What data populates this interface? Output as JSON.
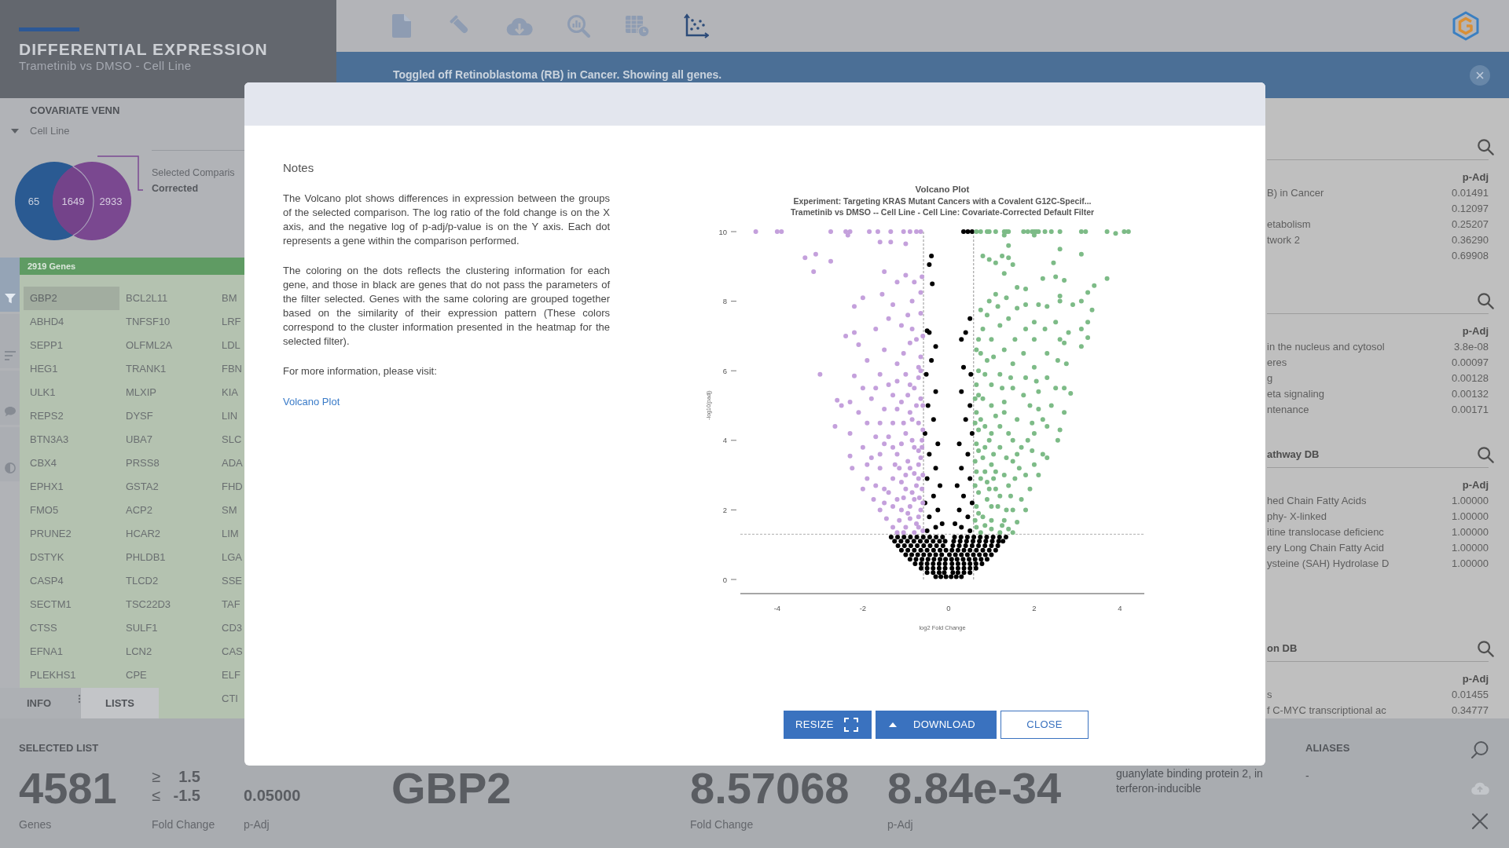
{
  "header": {
    "title": "DIFFERENTIAL EXPRESSION",
    "subtitle": "Trametinib vs DMSO - Cell Line"
  },
  "toolbar": [
    {
      "kind": "document",
      "selected": false
    },
    {
      "kind": "test-tube",
      "selected": false
    },
    {
      "kind": "cloud-download",
      "selected": false
    },
    {
      "kind": "magnifier-chart",
      "selected": false
    },
    {
      "kind": "table-clock",
      "selected": false
    },
    {
      "kind": "scatter-plot",
      "selected": true
    }
  ],
  "notification": {
    "message": "Toggled off Retinoblastoma (RB) in Cancer. Showing all genes."
  },
  "venn": {
    "title": "COVARIATE VENN",
    "dropdown": "Cell Line",
    "left_count": "65",
    "overlap_count": "1649",
    "right_count": "2933",
    "legend_label": "Selected Comparis",
    "legend_value": "Corrected"
  },
  "side_tools": [
    {
      "kind": "filter",
      "selected": true
    },
    {
      "kind": "sort",
      "selected": false
    },
    {
      "kind": "comment",
      "selected": false
    },
    {
      "kind": "contrast",
      "selected": false
    }
  ],
  "gene_list": {
    "header": "2919 Genes",
    "columns": [
      [
        {
          "name": "GBP2",
          "selected": true
        },
        {
          "name": "ABHD4",
          "selected": false
        },
        {
          "name": "SEPP1",
          "selected": false
        },
        {
          "name": "HEG1",
          "selected": false
        },
        {
          "name": "ULK1",
          "selected": false
        },
        {
          "name": "REPS2",
          "selected": false
        },
        {
          "name": "BTN3A3",
          "selected": false
        },
        {
          "name": "CBX4",
          "selected": false
        },
        {
          "name": "EPHX1",
          "selected": false
        },
        {
          "name": "FMO5",
          "selected": false
        },
        {
          "name": "PRUNE2",
          "selected": false
        },
        {
          "name": "DSTYK",
          "selected": false
        },
        {
          "name": "CASP4",
          "selected": false
        },
        {
          "name": "SECTM1",
          "selected": false
        },
        {
          "name": "CTSS",
          "selected": false
        },
        {
          "name": "EFNA1",
          "selected": false
        },
        {
          "name": "PLEKHS1",
          "selected": false
        }
      ],
      [
        {
          "name": "BCL2L11",
          "selected": false
        },
        {
          "name": "TNFSF10",
          "selected": false
        },
        {
          "name": "OLFML2A",
          "selected": false
        },
        {
          "name": "TRANK1",
          "selected": false
        },
        {
          "name": "MLXIP",
          "selected": false
        },
        {
          "name": "DYSF",
          "selected": false
        },
        {
          "name": "UBA7",
          "selected": false
        },
        {
          "name": "PRSS8",
          "selected": false
        },
        {
          "name": "GSTA2",
          "selected": false
        },
        {
          "name": "ACP2",
          "selected": false
        },
        {
          "name": "HCAR2",
          "selected": false
        },
        {
          "name": "PHLDB1",
          "selected": false
        },
        {
          "name": "TLCD2",
          "selected": false
        },
        {
          "name": "TSC22D3",
          "selected": false
        },
        {
          "name": "SULF1",
          "selected": false
        },
        {
          "name": "LCN2",
          "selected": false
        },
        {
          "name": "CPE",
          "selected": false
        }
      ],
      [
        {
          "name": "BM",
          "selected": false
        },
        {
          "name": "LRF",
          "selected": false
        },
        {
          "name": "LDL",
          "selected": false
        },
        {
          "name": "FBN",
          "selected": false
        },
        {
          "name": "KIA",
          "selected": false
        },
        {
          "name": "LIN",
          "selected": false
        },
        {
          "name": "SLC",
          "selected": false
        },
        {
          "name": "ADA",
          "selected": false
        },
        {
          "name": "FHD",
          "selected": false
        },
        {
          "name": "SM",
          "selected": false
        },
        {
          "name": "LIM",
          "selected": false
        },
        {
          "name": "LGA",
          "selected": false
        },
        {
          "name": "SSE",
          "selected": false
        },
        {
          "name": "TAF",
          "selected": false
        },
        {
          "name": "CD3",
          "selected": false
        },
        {
          "name": "CAS",
          "selected": false
        },
        {
          "name": "ELF",
          "selected": false
        },
        {
          "name": "CTI",
          "selected": false
        }
      ]
    ]
  },
  "tabs": [
    {
      "label": "INFO",
      "selected": false
    },
    {
      "label": "LISTS",
      "selected": true
    }
  ],
  "right_panel": {
    "sections": [
      {
        "column_header": "p-Adj",
        "rows": [
          {
            "name": "B) in Cancer",
            "p_adj": "0.01491"
          },
          {
            "p_adj": "0.12097"
          },
          {
            "name": "etabolism",
            "p_adj": "0.25207"
          },
          {
            "name": "twork 2",
            "p_adj": "0.36290"
          },
          {
            "p_adj": "0.69908"
          }
        ]
      },
      {
        "column_header": "p-Adj",
        "rows": [
          {
            "name": "in the nucleus and cytosol",
            "p_adj": "3.8e-08"
          },
          {
            "name": "eres",
            "p_adj": "0.00097"
          },
          {
            "name": "g",
            "p_adj": "0.00128"
          },
          {
            "name": "eta signaling",
            "p_adj": "0.00132"
          },
          {
            "name": "ntenance",
            "p_adj": "0.00171"
          }
        ]
      },
      {
        "title": "athway DB",
        "column_header": "p-Adj",
        "rows": [
          {
            "name": "hed Chain Fatty Acids",
            "p_adj": "1.00000"
          },
          {
            "name": "phy- X-linked",
            "p_adj": "1.00000"
          },
          {
            "name": "itine translocase deficienc",
            "p_adj": "1.00000"
          },
          {
            "name": "ery Long Chain Fatty Acid",
            "p_adj": "1.00000"
          },
          {
            "name": "ysteine (SAH) Hydrolase D",
            "p_adj": "1.00000"
          }
        ]
      },
      {
        "title": "on DB",
        "column_header": "p-Adj",
        "rows": [
          {
            "name": "s",
            "p_adj": "0.01455"
          },
          {
            "name": "f C-MYC transcriptional ac",
            "p_adj": "0.34777"
          }
        ]
      }
    ]
  },
  "summary": {
    "title": "SELECTED LIST",
    "count": "4581",
    "count_label": "Genes",
    "thresholds": [
      {
        "symbol": "≥",
        "value": "1.5"
      },
      {
        "symbol": "≤",
        "value": "-1.5"
      }
    ],
    "fold_change_label": "Fold Change",
    "p_adj": "0.05000",
    "p_adj_label": "p-Adj"
  },
  "gene_detail": {
    "symbol": "GBP2",
    "fold_change": "8.57068",
    "fold_change_label": "Fold Change",
    "p_adj": "8.84e-34",
    "p_adj_label": "p-Adj",
    "description": "guanylate binding protein 2, interferon-inducible",
    "aliases_title": "ALIASES",
    "aliases": "-"
  },
  "detail_actions": [
    {
      "kind": "search",
      "disabled": false
    },
    {
      "kind": "cloud",
      "disabled": true
    },
    {
      "kind": "close",
      "disabled": false
    }
  ],
  "dialog": {
    "notes_title": "Notes",
    "paragraphs": [
      "The Volcano plot shows differences in expression between the groups of the selected comparison. The log ratio of the fold change is on the X axis, and the negative log of p-adj/p-value is on the Y axis. Each dot represents a gene within the comparison performed.",
      "The coloring on the dots reflects the clustering information for each gene, and those in black are genes that do not pass the parameters of the filter selected. Genes with the same coloring are grouped together based on the similarity of their expression pattern (These colors correspond to the cluster information presented in the heatmap for the selected filter).",
      "For more information, please visit:"
    ],
    "link": "Volcano Plot",
    "chart_data": {
      "type": "scatter",
      "title": "Volcano Plot",
      "subtitle": [
        "Experiment: Targeting KRAS Mutant Cancers with a Covalent G12C-Specif...",
        "Trametinib vs DMSO -- Cell Line - Cell Line: Covariate-Corrected Default Filter"
      ],
      "xlabel": "log2 Fold Change",
      "ylabel": "-log10(padj)",
      "xlim": [
        -4.86,
        4.57
      ],
      "ylim": [
        0,
        10
      ],
      "xticks": [
        -4,
        -2,
        0,
        2,
        4
      ],
      "yticks": [
        0,
        2,
        4,
        6,
        8,
        10
      ],
      "ref_lines": [
        {
          "axis": "x",
          "value": -0.585
        },
        {
          "axis": "x",
          "value": 0.585
        },
        {
          "axis": "y",
          "value": 1.301
        }
      ],
      "series": [
        {
          "color": "#000000",
          "x": [
            -0.3,
            -0.18,
            -0.06,
            0.06,
            0.18,
            0.3,
            -0.5,
            -0.36,
            -0.22,
            -0.1,
            0.1,
            0.22,
            0.36,
            0.5,
            -0.64,
            -0.5,
            -0.36,
            -0.22,
            -0.08,
            0.08,
            0.22,
            0.36,
            0.5,
            0.64,
            -0.78,
            -0.64,
            -0.5,
            -0.36,
            -0.22,
            -0.08,
            0.08,
            0.22,
            0.36,
            0.5,
            0.64,
            0.78,
            -0.9,
            -0.76,
            -0.62,
            -0.48,
            -0.34,
            -0.2,
            -0.07,
            0.07,
            0.2,
            0.34,
            0.48,
            0.62,
            0.76,
            0.9,
            -1,
            -0.86,
            -0.72,
            -0.58,
            -0.44,
            -0.3,
            -0.16,
            0.02,
            0.16,
            0.3,
            0.44,
            0.58,
            0.72,
            0.86,
            1,
            -1.1,
            -0.95,
            -0.8,
            -0.65,
            -0.5,
            -0.35,
            -0.2,
            -0.06,
            0.08,
            0.22,
            0.36,
            0.5,
            0.65,
            0.8,
            0.95,
            1.1,
            -1.18,
            -1.03,
            -0.88,
            -0.73,
            -0.58,
            -0.43,
            -0.28,
            -0.13,
            0.1,
            0.25,
            0.4,
            0.55,
            0.7,
            0.85,
            1,
            1.15,
            -1.26,
            -1.11,
            -0.96,
            -0.81,
            -0.66,
            -0.51,
            -0.36,
            -0.21,
            -0.08,
            0.12,
            0.27,
            0.42,
            0.57,
            0.72,
            0.87,
            1.02,
            1.17,
            1.27,
            -1.34,
            -1.19,
            -1.04,
            -0.89,
            -0.74,
            -0.59,
            -0.44,
            -0.29,
            -0.14,
            0.14,
            0.29,
            0.44,
            0.59,
            0.74,
            0.89,
            1.04,
            1.19,
            1.34,
            -0.5,
            -0.3,
            -0.15,
            -0.45,
            -0.25,
            -0.55,
            -0.35,
            -0.2,
            -0.5,
            -0.3,
            -0.45,
            -0.25,
            -0.55,
            -0.35,
            -0.48,
            -0.3,
            -0.52,
            -0.4,
            -0.3,
            -0.5,
            -0.45,
            -0.4,
            -0.45,
            -0.38,
            0.5,
            0.3,
            0.15,
            0.45,
            0.25,
            0.55,
            0.35,
            0.2,
            0.5,
            0.3,
            0.45,
            0.25,
            0.55,
            0.4,
            0.5,
            0.3,
            0.52,
            0.35,
            0.3,
            0.4,
            0.5,
            0.35,
            0.45,
            0.55
          ],
          "values": [
            0.08,
            0.08,
            0.08,
            0.08,
            0.08,
            0.08,
            0.2,
            0.2,
            0.2,
            0.2,
            0.2,
            0.2,
            0.2,
            0.2,
            0.32,
            0.32,
            0.32,
            0.32,
            0.32,
            0.32,
            0.32,
            0.32,
            0.32,
            0.32,
            0.45,
            0.45,
            0.45,
            0.45,
            0.45,
            0.45,
            0.45,
            0.45,
            0.45,
            0.45,
            0.45,
            0.45,
            0.58,
            0.58,
            0.58,
            0.58,
            0.58,
            0.58,
            0.58,
            0.58,
            0.58,
            0.58,
            0.58,
            0.58,
            0.58,
            0.58,
            0.71,
            0.71,
            0.71,
            0.71,
            0.71,
            0.71,
            0.71,
            0.71,
            0.71,
            0.71,
            0.71,
            0.71,
            0.71,
            0.71,
            0.71,
            0.84,
            0.84,
            0.84,
            0.84,
            0.84,
            0.84,
            0.84,
            0.84,
            0.84,
            0.84,
            0.84,
            0.84,
            0.84,
            0.84,
            0.84,
            0.84,
            0.97,
            0.97,
            0.97,
            0.97,
            0.97,
            0.97,
            0.97,
            0.97,
            0.97,
            0.97,
            0.97,
            0.97,
            0.97,
            0.97,
            0.97,
            0.97,
            1.1,
            1.1,
            1.1,
            1.1,
            1.1,
            1.1,
            1.1,
            1.1,
            1.1,
            1.1,
            1.1,
            1.1,
            1.1,
            1.1,
            1.1,
            1.1,
            1.1,
            1.1,
            1.22,
            1.22,
            1.22,
            1.22,
            1.22,
            1.22,
            1.22,
            1.22,
            1.22,
            1.22,
            1.22,
            1.22,
            1.22,
            1.22,
            1.22,
            1.22,
            1.22,
            1.22,
            1.4,
            1.5,
            1.6,
            1.8,
            2,
            2.2,
            2.4,
            2.7,
            2.9,
            3.2,
            3.6,
            3.9,
            4.2,
            4.6,
            5,
            5.4,
            5.9,
            6.3,
            6.7,
            7.15,
            7.1,
            9.3,
            9.05,
            8.5,
            1.4,
            1.5,
            1.6,
            1.8,
            2,
            2.2,
            2.4,
            2.7,
            2.9,
            3.2,
            3.6,
            3.9,
            4.2,
            4.6,
            5,
            5.4,
            5.9,
            6.1,
            6.9,
            7.1,
            7.5,
            10,
            10,
            10
          ]
        },
        {
          "color": "#c4a0dc",
          "x": [
            -4.5,
            -4,
            -3.9,
            -2.75,
            -2.4,
            -2.3,
            -1.85,
            -1.65,
            -1.35,
            -1.05,
            -0.9,
            -0.75,
            -0.65,
            -2.35,
            -1.6,
            -1.35,
            -1,
            -3.35,
            -3.1,
            -2.75,
            -3.15,
            -1.5,
            -1,
            -1.2,
            -0.8,
            -0.62,
            -0.65,
            -1.55,
            -2,
            -0.85,
            -2.2,
            -1.3,
            -0.95,
            -0.65,
            -1.4,
            -2.4,
            -2.2,
            -1.7,
            -1.1,
            -0.75,
            -2.1,
            -1.5,
            -0.9,
            -0.65,
            -1.9,
            -1.2,
            -3,
            -2.2,
            -1.6,
            -1,
            -0.7,
            -2,
            -1.4,
            -0.8,
            -2.6,
            -2.3,
            -1.8,
            -1.1,
            -0.65,
            -2.5,
            -2.1,
            -1.5,
            -0.9,
            -2.65,
            -1.9,
            -1.3,
            -0.7,
            -2.3,
            -1.7,
            -1,
            -0.62,
            -2,
            -1.5,
            -0.8,
            -2.3,
            -1.8,
            -1.2,
            -0.65,
            -2.25,
            -1.6,
            -0.9,
            -1.9,
            -1.3,
            -0.7,
            -2,
            -1.5,
            -1,
            -0.62,
            -1.75,
            -1.2,
            -0.8,
            -1.6,
            -1.1,
            -0.65,
            -1.45,
            -0.9,
            -1.3,
            -1,
            -0.7,
            -1.2,
            -0.8,
            -0.6,
            -0.75,
            -0.95,
            -0.6,
            -0.85,
            -1.1,
            -0.6,
            -0.95,
            -0.7,
            -1.1,
            -0.6,
            -0.85,
            -1.2,
            -0.6,
            -0.95,
            -0.7,
            -1.05,
            -0.6,
            -0.85,
            -1.3,
            -1.4,
            -1.25,
            -1.4,
            -1.3,
            -1.5,
            -1.7,
            -1.9,
            -0.7,
            -0.9,
            -1.05,
            -0.75,
            -0.8,
            -1,
            -0.7,
            -0.85,
            -1.05,
            -0.75,
            -0.9,
            -0.65,
            -1.15,
            -1.05,
            -0.68,
            -1.15,
            -0.62,
            -1.3,
            -1.6,
            -1.6,
            -1.7,
            -1.2
          ],
          "values": [
            10,
            10,
            10,
            10,
            10,
            10,
            10,
            10,
            10,
            10,
            10,
            10,
            10,
            9.9,
            9.7,
            9.7,
            9.65,
            9.25,
            9.35,
            9.15,
            8.85,
            8.85,
            8.75,
            8.55,
            8.55,
            8.7,
            8.25,
            8.2,
            8.1,
            8,
            7.85,
            7.9,
            7.6,
            7.65,
            7.5,
            7,
            7.1,
            7.2,
            7.3,
            6.9,
            6.75,
            6.6,
            6.8,
            6.4,
            6.3,
            6.2,
            5.9,
            5.85,
            5.9,
            5.9,
            5.8,
            5.5,
            5.6,
            5.5,
            5.15,
            5.1,
            5.2,
            5.1,
            5.2,
            5,
            4.8,
            4.9,
            4.8,
            4.4,
            4.5,
            4.5,
            4.5,
            4.2,
            4.1,
            4.2,
            4,
            3.8,
            3.9,
            3.8,
            3.55,
            3.5,
            3.6,
            3.5,
            3.2,
            3.2,
            3.2,
            2.9,
            2.9,
            2.9,
            2.6,
            2.6,
            2.6,
            2.6,
            2.3,
            2.3,
            2.3,
            2,
            2,
            2,
            1.75,
            1.75,
            1.5,
            1.5,
            1.5,
            1.35,
            1.35,
            1.4,
            1.6,
            1.9,
            2.2,
            2.5,
            2.8,
            3,
            3.4,
            3.7,
            3.9,
            4.3,
            4.6,
            4.9,
            5,
            5.3,
            6.1,
            6.5,
            7,
            7.2,
            5.3,
            4.1,
            3.3,
            2.5,
            2.1,
            2.2,
            2.7,
            3.3,
            1.8,
            2.1,
            2.35,
            2.7,
            3.05,
            3,
            3.3,
            4,
            4.5,
            5,
            5.6,
            6,
            1.7,
            1.35,
            2.35,
            3.2,
            3.8,
            3.8,
            3.6,
            4.5,
            5.5,
            5.7
          ]
        },
        {
          "color": "#7dbb87",
          "x": [
            0.65,
            0.75,
            0.9,
            0.95,
            1.1,
            1.3,
            1.35,
            1.4,
            1.75,
            1.85,
            1.95,
            2,
            2.05,
            2.1,
            2.25,
            2.4,
            2.6,
            3.1,
            3.2,
            3.7,
            4.1,
            4.2,
            3.9,
            1.3,
            2,
            1.4,
            2.6,
            3.1,
            0.8,
            0.95,
            1.25,
            1.4,
            1.1,
            1.5,
            2.45,
            1.3,
            2.5,
            2.2,
            3.7,
            2.7,
            3.4,
            1.6,
            1.8,
            2.6,
            3.25,
            1.1,
            1.35,
            2.6,
            3.1,
            0.95,
            1.8,
            2.1,
            2.9,
            0.75,
            1.15,
            1.6,
            2.3,
            3.35,
            0.9,
            1.4,
            2,
            2.5,
            3.25,
            0.8,
            1.2,
            1.8,
            2.25,
            2.8,
            3.1,
            0.7,
            1,
            1.55,
            2,
            2.6,
            3.25,
            3.1,
            0.65,
            1.3,
            1.75,
            2.3,
            2.7,
            0.9,
            1.5,
            2,
            2.55,
            2.75,
            0.7,
            1.2,
            1.8,
            2.3,
            2.85,
            2.7,
            0.65,
            1,
            1.5,
            2.1,
            2.5,
            0.8,
            1.3,
            1.9,
            2.4,
            2.7,
            0.65,
            1.1,
            1.6,
            2.2,
            2.6,
            2.55,
            0.7,
            1,
            1.4,
            2,
            2.3,
            0.65,
            1.2,
            1.7,
            2.2,
            0.8,
            1.5,
            2,
            2.3,
            0.65,
            1.1,
            1.8,
            2.1,
            0.9,
            1.4,
            1.9,
            0.7,
            1.2,
            1.7,
            0.65,
            1,
            1.5,
            1.8,
            0.8,
            1.3,
            1.6,
            0.65,
            1,
            1.4,
            0.75,
            1.2,
            1.5,
            0.7,
            0.9,
            1.1,
            0.75,
            1,
            0.7,
            0.95,
            1.2,
            0.75,
            1,
            0.7,
            1.25,
            0.85,
            1.05,
            0.75,
            1.3,
            1.55,
            1.6,
            1.85,
            1.5,
            1.3,
            1.75,
            1.95,
            1.45,
            2.05,
            1.15,
            1.35,
            1,
            0.85,
            1.25,
            0.62,
            0.62,
            0.62,
            0.62,
            0.62,
            0.85,
            0.85,
            0.85,
            1.05,
            1.05,
            1.35,
            1.45,
            1.65,
            1.95,
            2.1,
            0.95
          ],
          "values": [
            10,
            10,
            10,
            10,
            10,
            10,
            10,
            10,
            10,
            10,
            10,
            10,
            10,
            10,
            10,
            10,
            10,
            10,
            10,
            10,
            10,
            10,
            9.95,
            9.9,
            9.9,
            9.6,
            9.5,
            9.35,
            9.3,
            9.2,
            9.3,
            9.25,
            9.1,
            9.05,
            9.1,
            8.8,
            8.7,
            8.65,
            8.65,
            8.6,
            8.45,
            8.4,
            8.35,
            8.15,
            8.25,
            8.2,
            8.1,
            8,
            8,
            8,
            7.9,
            7.9,
            7.9,
            7.75,
            7.85,
            7.8,
            7.85,
            7.75,
            7.6,
            7.5,
            7.4,
            7.4,
            7.4,
            7.2,
            7.3,
            7.2,
            7.2,
            7.1,
            7.2,
            6.9,
            6.9,
            6.9,
            6.9,
            6.9,
            6.95,
            6.7,
            6.6,
            6.6,
            6.5,
            6.5,
            6.8,
            6.3,
            6.2,
            6.1,
            6.3,
            6.2,
            6,
            5.9,
            5.8,
            5.8,
            5.35,
            5.5,
            5.6,
            5.6,
            5.5,
            5.4,
            5.5,
            5.2,
            5.1,
            5,
            5,
            4.8,
            4.8,
            4.7,
            4.6,
            4.6,
            4.3,
            4,
            4.3,
            4.2,
            4.2,
            4.2,
            4.4,
            3.9,
            3.8,
            3.8,
            3.6,
            3.5,
            3.4,
            3.3,
            3.5,
            3.1,
            3.1,
            3,
            3,
            2.8,
            2.7,
            2.6,
            2.5,
            2.4,
            2.3,
            2.1,
            2.1,
            2,
            2,
            1.8,
            1.7,
            1.65,
            1.5,
            1.45,
            1.45,
            1.35,
            1.35,
            1.35,
            1.9,
            2.3,
            2.6,
            2.9,
            3.3,
            3.7,
            4,
            4.4,
            4.6,
            5,
            5.3,
            5.5,
            5.9,
            6.4,
            6.5,
            3,
            2.9,
            3.6,
            4,
            4,
            4.8,
            5.3,
            4.5,
            5.8,
            5.7,
            2.1,
            2,
            1.7,
            1.55,
            1.55,
            1.7,
            2.7,
            3.4,
            4.5,
            5.2,
            3.1,
            3.8,
            4.4,
            3.6,
            2.9,
            3.5,
            2.4,
            3.2,
            3.7,
            4.9,
            2.6
          ]
        }
      ]
    },
    "buttons": [
      {
        "kind": "resize",
        "label": "RESIZE"
      },
      {
        "kind": "download",
        "label": "DOWNLOAD"
      },
      {
        "kind": "close",
        "label": "CLOSE"
      }
    ]
  }
}
